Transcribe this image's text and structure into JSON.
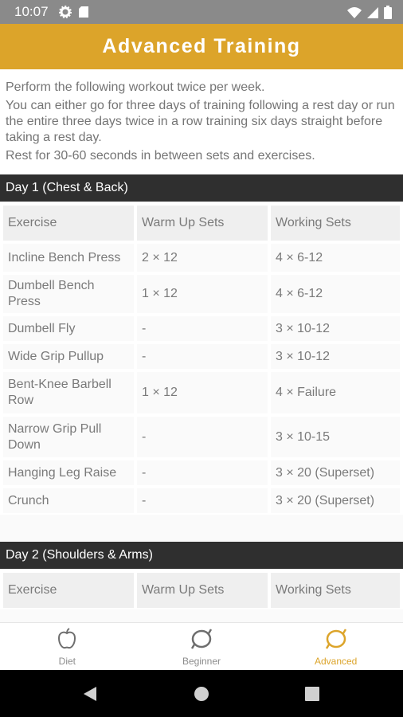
{
  "status_bar": {
    "time": "10:07"
  },
  "app_bar": {
    "title": "Advanced Training"
  },
  "intro": {
    "lines": [
      "Perform the following workout twice per week.",
      "You can either go for three days of training following a rest day or run the entire three days twice in a row training six days straight before taking a rest day.",
      "Rest for 30-60 seconds in between sets and exercises."
    ]
  },
  "day1": {
    "title": "Day 1 (Chest & Back)",
    "headers": [
      "Exercise",
      "Warm Up Sets",
      "Working Sets"
    ],
    "rows": [
      [
        "Incline Bench Press",
        "2 × 12",
        "4 × 6-12"
      ],
      [
        "Dumbell Bench Press",
        "1 × 12",
        "4 × 6-12"
      ],
      [
        "Dumbell Fly",
        "-",
        "3 × 10-12"
      ],
      [
        "Wide Grip Pullup",
        "-",
        "3 × 10-12"
      ],
      [
        "Bent-Knee Barbell Row",
        "1 × 12",
        "4 × Failure"
      ],
      [
        "Narrow Grip Pull Down",
        "-",
        "3 × 10-15"
      ],
      [
        "Hanging Leg Raise",
        "-",
        "3 × 20 (Superset)"
      ],
      [
        "Crunch",
        "-",
        "3 × 20 (Superset)"
      ]
    ]
  },
  "day2": {
    "title": "Day 2 (Shoulders & Arms)",
    "headers": [
      "Exercise",
      "Warm Up Sets",
      "Working Sets"
    ]
  },
  "bottom_nav": {
    "items": [
      {
        "label": "Diet",
        "icon": "apple-icon",
        "active": false
      },
      {
        "label": "Beginner",
        "icon": "ring-icon",
        "active": false
      },
      {
        "label": "Advanced",
        "icon": "ring-icon",
        "active": true
      }
    ]
  },
  "colors": {
    "accent": "#dca42a",
    "day_header": "#2f2f2f",
    "status_bar": "#8a8a8a"
  }
}
